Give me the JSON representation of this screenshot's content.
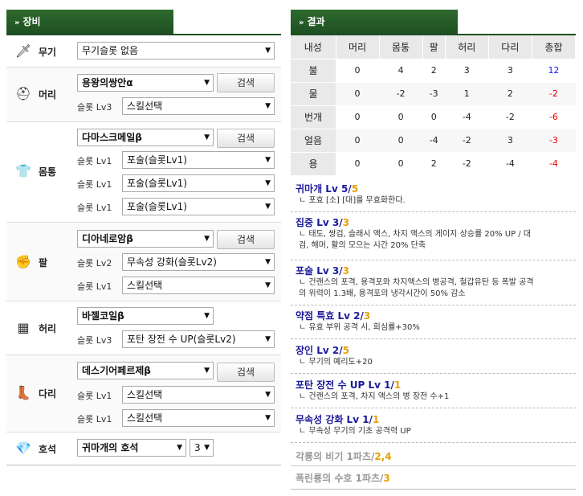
{
  "equipment": {
    "title": "장비",
    "weapon": {
      "label": "무기",
      "select": "무기슬롯 없음"
    },
    "head": {
      "label": "머리",
      "item": "용왕의쌍안α",
      "search": "검색",
      "slots": [
        {
          "lv": "슬롯 Lv3",
          "value": "스킬선택"
        }
      ]
    },
    "body": {
      "label": "몸통",
      "item": "다마스크메일β",
      "search": "검색",
      "slots": [
        {
          "lv": "슬롯 Lv1",
          "value": "포술(슬롯Lv1)"
        },
        {
          "lv": "슬롯 Lv1",
          "value": "포술(슬롯Lv1)"
        },
        {
          "lv": "슬롯 Lv1",
          "value": "포술(슬롯Lv1)"
        }
      ]
    },
    "arm": {
      "label": "팔",
      "item": "디아네로암β",
      "search": "검색",
      "slots": [
        {
          "lv": "슬롯 Lv2",
          "value": "무속성 강화(슬롯Lv2)"
        },
        {
          "lv": "슬롯 Lv1",
          "value": "스킬선택"
        }
      ]
    },
    "waist": {
      "label": "허리",
      "item": "바젤코일β",
      "slots": [
        {
          "lv": "슬롯 Lv3",
          "value": "포탄 장전 수 UP(슬롯Lv2)"
        }
      ]
    },
    "leg": {
      "label": "다리",
      "item": "데스기어페르제β",
      "search": "검색",
      "slots": [
        {
          "lv": "슬롯 Lv1",
          "value": "스킬선택"
        },
        {
          "lv": "슬롯 Lv1",
          "value": "스킬선택"
        }
      ]
    },
    "charm": {
      "label": "호석",
      "item": "귀마개의 호석",
      "level": "3"
    }
  },
  "result": {
    "title": "결과",
    "headers": [
      "내성",
      "머리",
      "몸통",
      "팔",
      "허리",
      "다리",
      "총합"
    ],
    "rows": [
      {
        "name": "불",
        "vals": [
          "0",
          "4",
          "2",
          "3",
          "3"
        ],
        "total": "12",
        "sign": "pos"
      },
      {
        "name": "물",
        "vals": [
          "0",
          "-2",
          "-3",
          "1",
          "2"
        ],
        "total": "-2",
        "sign": "neg"
      },
      {
        "name": "번개",
        "vals": [
          "0",
          "0",
          "0",
          "-4",
          "-2"
        ],
        "total": "-6",
        "sign": "neg"
      },
      {
        "name": "얼음",
        "vals": [
          "0",
          "0",
          "-4",
          "-2",
          "3"
        ],
        "total": "-3",
        "sign": "neg"
      },
      {
        "name": "용",
        "vals": [
          "0",
          "0",
          "2",
          "-2",
          "-4"
        ],
        "total": "-4",
        "sign": "neg"
      }
    ],
    "skills": [
      {
        "name": "귀마개 Lv 5/",
        "max": "5",
        "desc": [
          "ㄴ 포효 [소] [대]를 무효화한다."
        ]
      },
      {
        "name": "집중 Lv 3/",
        "max": "3",
        "desc": [
          "ㄴ 태도, 쌍검, 슬래시 액스, 차지 액스의 게이지 상승률 20% UP / 대",
          "검, 해머, 활의 모으는 시간 20% 단축"
        ]
      },
      {
        "name": "포술 Lv 3/",
        "max": "3",
        "desc": [
          "ㄴ 건랜스의 포격, 용격포와 차지액스의 병공격, 철갑유탄 등 폭발 공격",
          "의 위력이 1.3배, 용격포의 냉각시간이 50% 감소"
        ]
      },
      {
        "name": "약점 특효 Lv 2/",
        "max": "3",
        "desc": [
          "ㄴ 유효 부위 공격 시, 회심률+30%"
        ]
      },
      {
        "name": "장인 Lv 2/",
        "max": "5",
        "desc": [
          "ㄴ 무기의 예리도+20"
        ]
      },
      {
        "name": "포탄 장전 수 UP Lv 1/",
        "max": "1",
        "desc": [
          "ㄴ 건랜스의 포격, 차지 액스의 병 장전 수+1"
        ]
      },
      {
        "name": "무속성 강화 Lv 1/",
        "max": "1",
        "desc": [
          "ㄴ 무속성 무기의 기초 공격력 UP"
        ]
      }
    ],
    "sets": [
      {
        "name": "각룡의 비기 1파츠/",
        "max": "2,4"
      },
      {
        "name": "폭린룡의 수호 1파츠/",
        "max": "3"
      }
    ]
  }
}
